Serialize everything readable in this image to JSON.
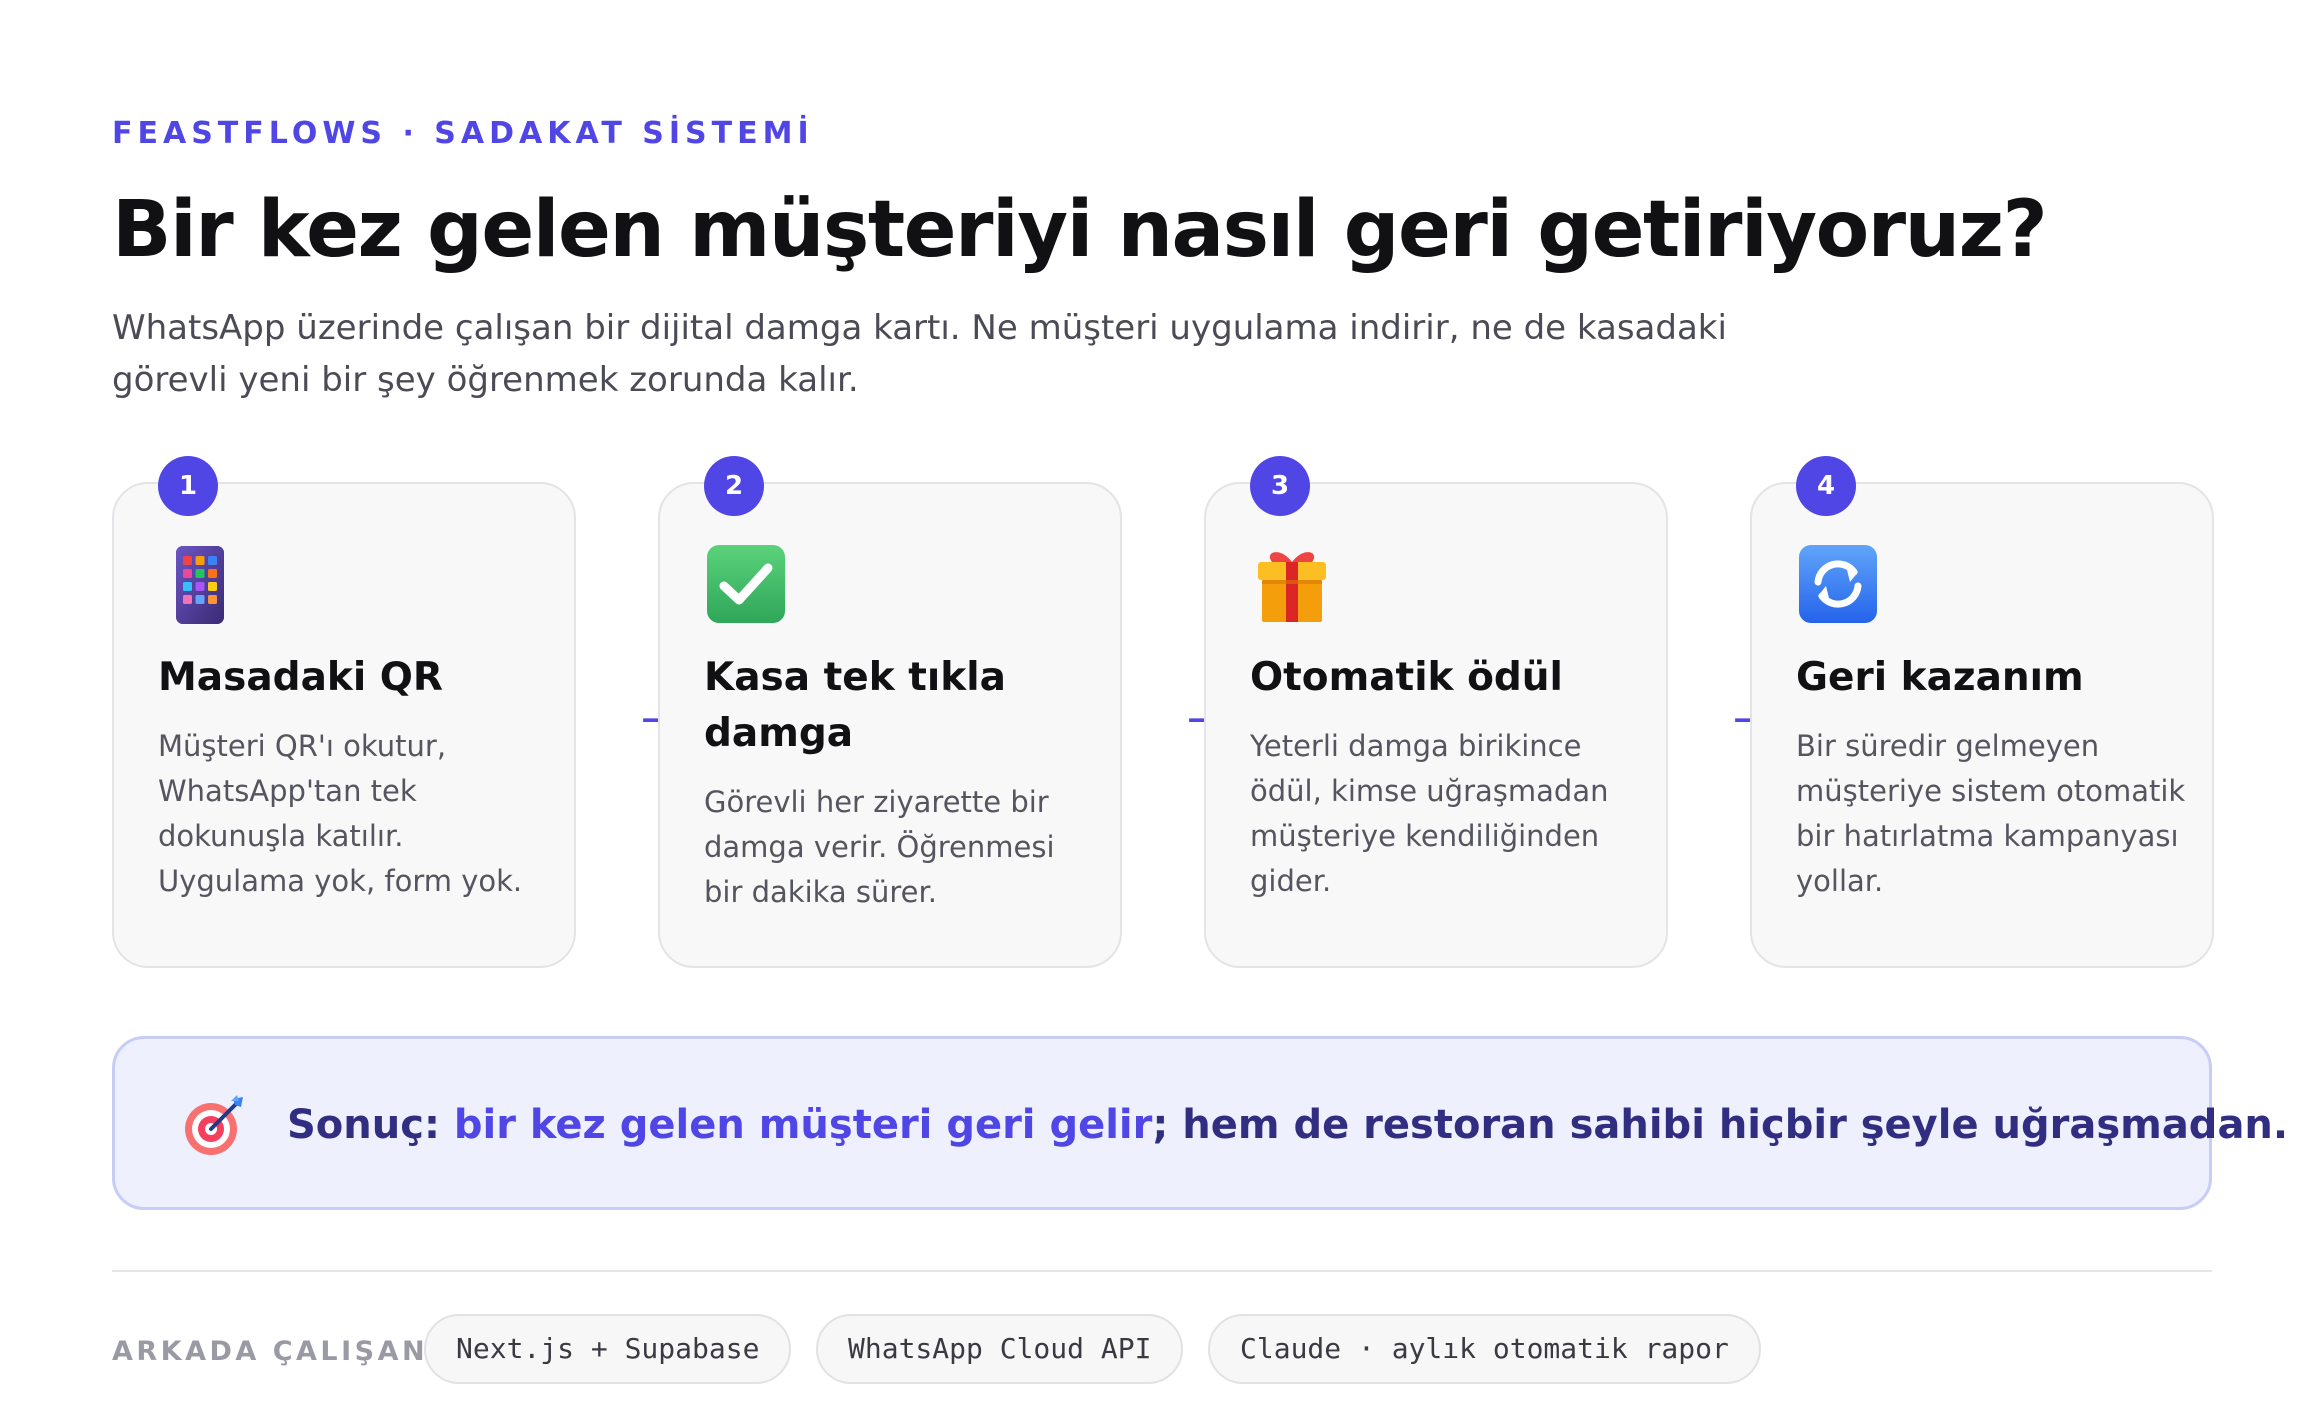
{
  "header": {
    "eyebrow": "FEASTFLOWS · SADAKAT SİSTEMİ",
    "title": "Bir kez gelen müşteriyi nasıl geri getiriyoruz?",
    "subtitle": "WhatsApp üzerinde çalışan bir dijital damga kartı. Ne müşteri uygulama indirir, ne de kasadaki görevli yeni bir şey öğrenmek zorunda kalır."
  },
  "steps": [
    {
      "number": "1",
      "icon": "qr-grid-icon",
      "title": "Masadaki QR",
      "description": "Müşteri QR'ı okutur, WhatsApp'tan tek dokunuşla katılır. Uygulama yok, form yok."
    },
    {
      "number": "2",
      "icon": "check-mark-icon",
      "title": "Kasa tek tıkla damga",
      "description": "Görevli her ziyarette bir damga verir. Öğrenmesi bir dakika sürer."
    },
    {
      "number": "3",
      "icon": "gift-icon",
      "title": "Otomatik ödül",
      "description": "Yeterli damga birikince ödül, kimse uğraşmadan müşteriye kendiliğinden gider."
    },
    {
      "number": "4",
      "icon": "refresh-icon",
      "title": "Geri kazanım",
      "description": "Bir süredir gelmeyen müşteriye sistem otomatik bir hatırlatma kampanyası yollar."
    }
  ],
  "arrows": [
    "→",
    "→",
    "→"
  ],
  "result": {
    "icon": "target-dart-icon",
    "lead": "Sonuç: ",
    "highlight": "bir kez gelen müşteri geri gelir",
    "rest": "; hem de restoran sahibi hiçbir şeyle uğraşmadan."
  },
  "stack": {
    "label": "ARKADA ÇALIŞAN",
    "chips": [
      "Next.js + Supabase",
      "WhatsApp Cloud API",
      "Claude · aylık otomatik rapor"
    ]
  },
  "colors": {
    "accent": "#4f46e5",
    "result_text": "#312e81",
    "result_bg": "#eef0fe",
    "card_bg": "#f8f8f9"
  }
}
